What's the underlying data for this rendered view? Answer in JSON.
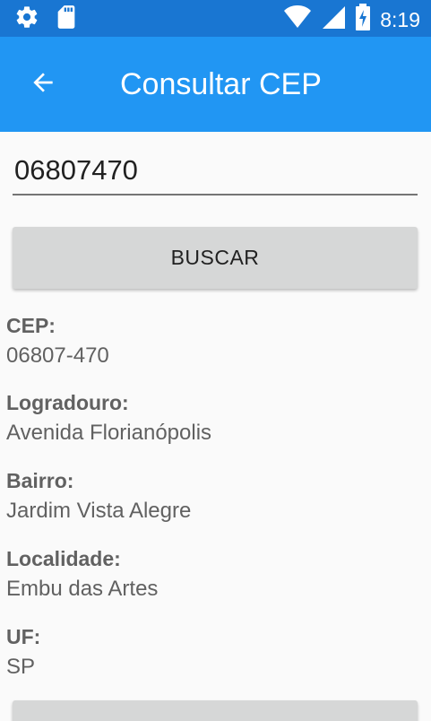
{
  "status_bar": {
    "time": "8:19",
    "icons": [
      "settings-icon",
      "sd-card-icon",
      "wifi-icon",
      "signal-icon",
      "battery-charging-icon"
    ]
  },
  "app_bar": {
    "title": "Consultar CEP",
    "back_icon": "arrow-back-icon"
  },
  "search": {
    "value": "06807470"
  },
  "buttons": {
    "search_label": "BUSCAR"
  },
  "results": [
    {
      "label": "CEP:",
      "value": "06807-470"
    },
    {
      "label": "Logradouro:",
      "value": "Avenida Florianópolis"
    },
    {
      "label": "Bairro:",
      "value": "Jardim Vista Alegre"
    },
    {
      "label": "Localidade:",
      "value": "Embu das Artes"
    },
    {
      "label": "UF:",
      "value": "SP"
    }
  ],
  "colors": {
    "status_bar": "#1976d2",
    "app_bar": "#2196f3",
    "button": "#d6d7d7",
    "label_text": "#616161"
  }
}
